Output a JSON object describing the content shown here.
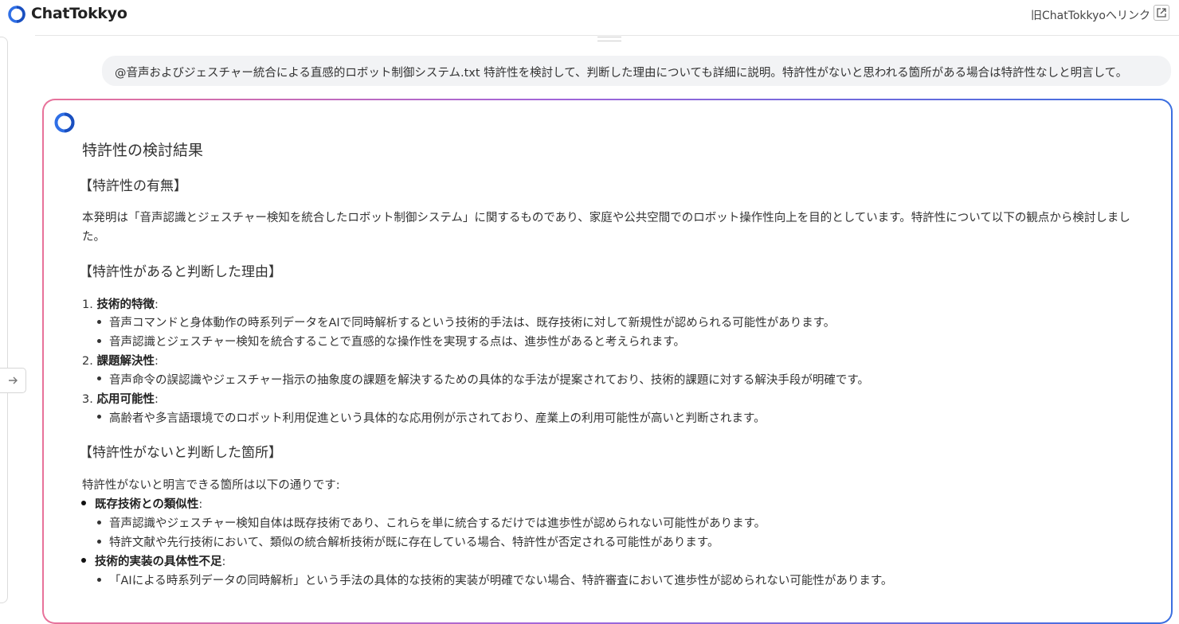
{
  "header": {
    "brand": "ChatTokkyo",
    "old_link": "旧ChatTokkyoへリンク"
  },
  "user_message": "@音声およびジェスチャー統合による直感的ロボット制御システム.txt 特許性を検討して、判断した理由についても詳細に説明。特許性がないと思われる箇所がある場合は特許性なしと明言して。",
  "answer": {
    "title": "特許性の検討結果",
    "sec1_heading": "【特許性の有無】",
    "intro_line1": "本発明は「音声認識とジェスチャー検知を統合したロボット制御システム」に関するものであり、家庭や公共空間でのロボット操作性向上を目的としています。特許性について以下の観点から検討しまし",
    "intro_line2": "た。",
    "sec2_heading": "【特許性があると判断した理由】",
    "reasons": [
      {
        "num": "1.",
        "title": "技術的特徴",
        "bullets": [
          "音声コマンドと身体動作の時系列データをAIで同時解析するという技術的手法は、既存技術に対して新規性が認められる可能性があります。",
          "音声認識とジェスチャー検知を統合することで直感的な操作性を実現する点は、進歩性があると考えられます。"
        ]
      },
      {
        "num": "2.",
        "title": "課題解決性",
        "bullets": [
          "音声命令の誤認識やジェスチャー指示の抽象度の課題を解決するための具体的な手法が提案されており、技術的課題に対する解決手段が明確です。"
        ]
      },
      {
        "num": "3.",
        "title": "応用可能性",
        "bullets": [
          "高齢者や多言語環境でのロボット利用促進という具体的な応用例が示されており、産業上の利用可能性が高いと判断されます。"
        ]
      }
    ],
    "sec3_heading": "【特許性がないと判断した箇所】",
    "sec3_intro": "特許性がないと明言できる箇所は以下の通りです:",
    "issues": [
      {
        "title": "既存技術との類似性",
        "bullets": [
          "音声認識やジェスチャー検知自体は既存技術であり、これらを単に統合するだけでは進歩性が認められない可能性があります。",
          "特許文献や先行技術において、類似の統合解析技術が既に存在している場合、特許性が否定される可能性があります。"
        ]
      },
      {
        "title": "技術的実装の具体性不足",
        "bullets": [
          "「AIによる時系列データの同時解析」という手法の具体的な技術的実装が明確でない場合、特許審査において進歩性が認められない可能性があります。"
        ]
      }
    ]
  },
  "colors": {
    "gradient_start": "#e8729a",
    "gradient_mid": "#a265d9",
    "gradient_end": "#3b6fe0",
    "user_bubble_bg": "#f2f3f5"
  },
  "icons": {
    "logo": "chattokkyo-logo-icon",
    "external": "external-link-icon",
    "expand": "arrow-right-icon"
  }
}
